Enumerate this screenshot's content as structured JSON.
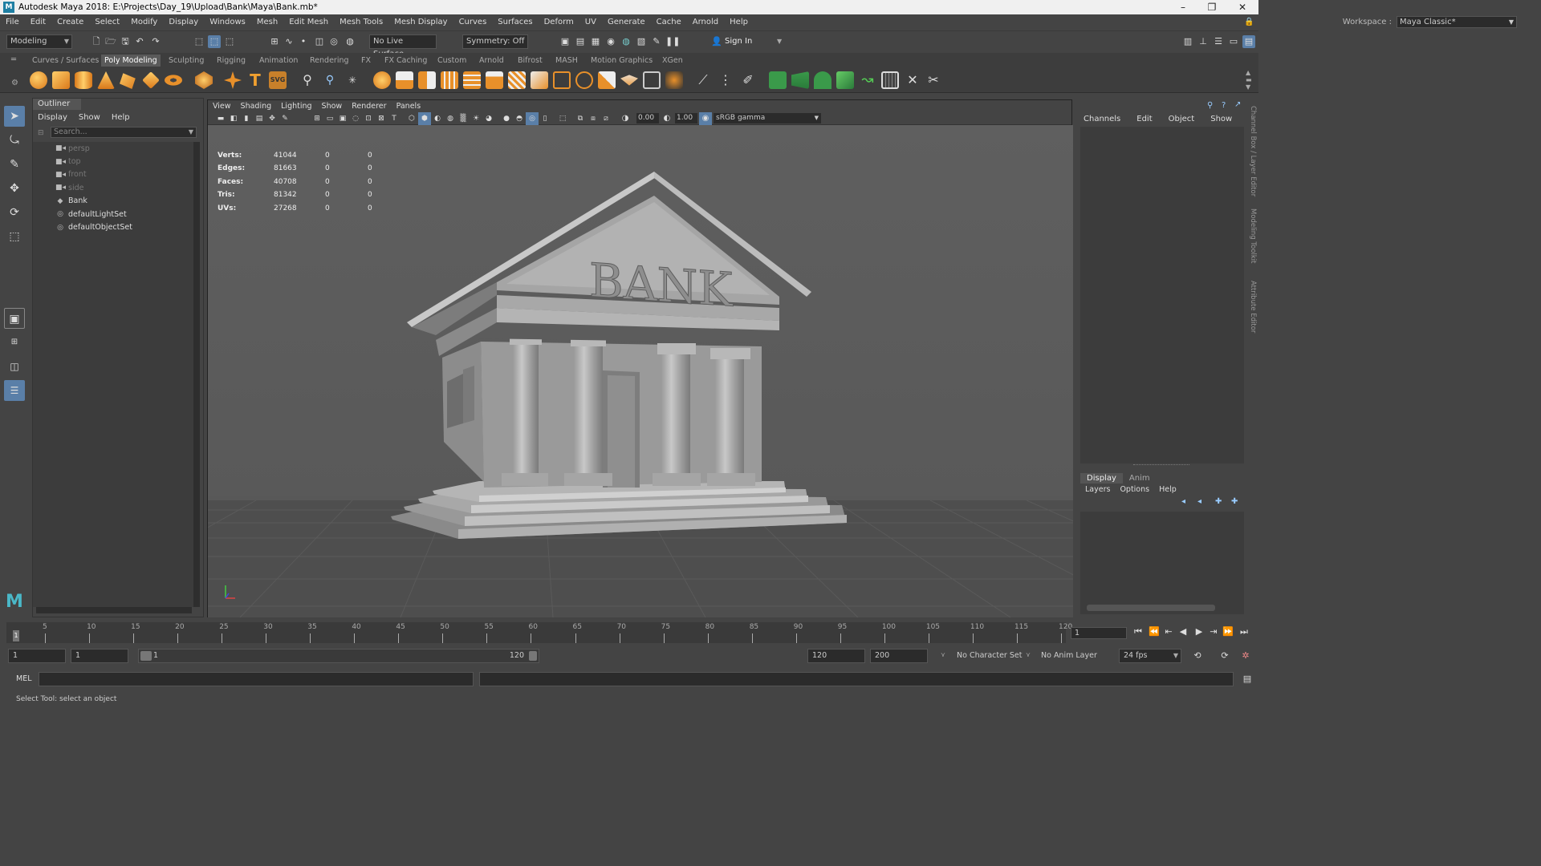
{
  "window": {
    "title": "Autodesk Maya 2018: E:\\Projects\\Day_19\\Upload\\Bank\\Maya\\Bank.mb*"
  },
  "menus": [
    "File",
    "Edit",
    "Create",
    "Select",
    "Modify",
    "Display",
    "Windows",
    "Mesh",
    "Edit Mesh",
    "Mesh Tools",
    "Mesh Display",
    "Curves",
    "Surfaces",
    "Deform",
    "UV",
    "Generate",
    "Cache",
    "Arnold",
    "Help"
  ],
  "workspace": {
    "label": "Workspace :",
    "value": "Maya Classic*"
  },
  "statusline": {
    "mode": "Modeling",
    "live_surface": "No Live Surface",
    "symmetry": "Symmetry: Off",
    "sign_in": "Sign In"
  },
  "shelf_tabs": [
    "Curves / Surfaces",
    "Poly Modeling",
    "Sculpting",
    "Rigging",
    "Animation",
    "Rendering",
    "FX",
    "FX Caching",
    "Custom",
    "Arnold",
    "Bifrost",
    "MASH",
    "Motion Graphics",
    "XGen"
  ],
  "outliner": {
    "title": "Outliner",
    "menus": [
      "Display",
      "Show",
      "Help"
    ],
    "search_placeholder": "Search...",
    "items": [
      "persp",
      "top",
      "front",
      "side",
      "Bank",
      "defaultLightSet",
      "defaultObjectSet"
    ]
  },
  "viewport": {
    "menus": [
      "View",
      "Shading",
      "Lighting",
      "Show",
      "Renderer",
      "Panels"
    ],
    "exposure": "0.00",
    "gamma": "1.00",
    "colorspace": "sRGB gamma",
    "camera": "persp",
    "sign_text": "BANK",
    "hud": [
      {
        "label": "Verts:",
        "v": "41044",
        "a": "0",
        "b": "0"
      },
      {
        "label": "Edges:",
        "v": "81663",
        "a": "0",
        "b": "0"
      },
      {
        "label": "Faces:",
        "v": "40708",
        "a": "0",
        "b": "0"
      },
      {
        "label": "Tris:",
        "v": "81342",
        "a": "0",
        "b": "0"
      },
      {
        "label": "UVs:",
        "v": "27268",
        "a": "0",
        "b": "0"
      }
    ]
  },
  "channelbox": {
    "menus": [
      "Channels",
      "Edit",
      "Object",
      "Show"
    ]
  },
  "layers": {
    "tabs": [
      "Display",
      "Anim"
    ],
    "menus": [
      "Layers",
      "Options",
      "Help"
    ]
  },
  "sidetabs": [
    "Channel Box / Layer Editor",
    "Modeling Toolkit",
    "Attribute Editor"
  ],
  "timeline": {
    "labels": [
      "5",
      "10",
      "15",
      "20",
      "25",
      "30",
      "35",
      "40",
      "45",
      "50",
      "55",
      "60",
      "65",
      "70",
      "75",
      "80",
      "85",
      "90",
      "95",
      "100",
      "105",
      "110",
      "115",
      "120"
    ],
    "start_marker": "1",
    "current_frame": "1"
  },
  "range": {
    "start": "1",
    "inner_start": "1",
    "slider_start": "1",
    "slider_end": "120",
    "end": "120",
    "outer_end": "200",
    "character_set": "No Character Set",
    "anim_layer": "No Anim Layer",
    "fps": "24 fps"
  },
  "cmd": {
    "label": "MEL"
  },
  "help": {
    "text": "Select Tool: select an object"
  }
}
